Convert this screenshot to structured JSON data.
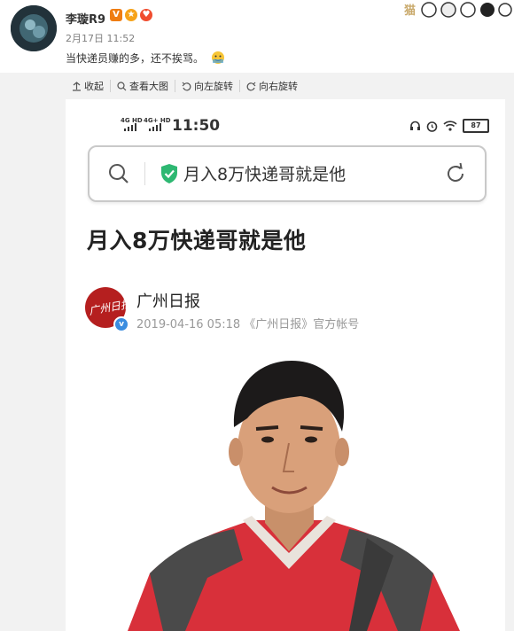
{
  "post": {
    "username": "李璇R9",
    "timestamp": "2月17日 11:52",
    "text": "当快递员赚的多，还不挨骂。",
    "badge_v": "V"
  },
  "toolbar": {
    "collapse": "收起",
    "view_large": "查看大图",
    "rotate_left": "向左旋转",
    "rotate_right": "向右旋转"
  },
  "phone": {
    "signal1": "4G HD",
    "signal2": "4G+ HD",
    "time": "11:50",
    "battery": "87",
    "search_title": "月入8万快递哥就是他"
  },
  "article": {
    "title": "月入8万快递哥就是他",
    "publisher": "广州日报",
    "meta": "2019-04-16 05:18   《广州日报》官方帐号",
    "logo_text": "广州日报"
  },
  "colors": {
    "accent_green": "#2eb872",
    "verified_blue": "#3b8de0",
    "logo_red": "#b51f1f"
  }
}
